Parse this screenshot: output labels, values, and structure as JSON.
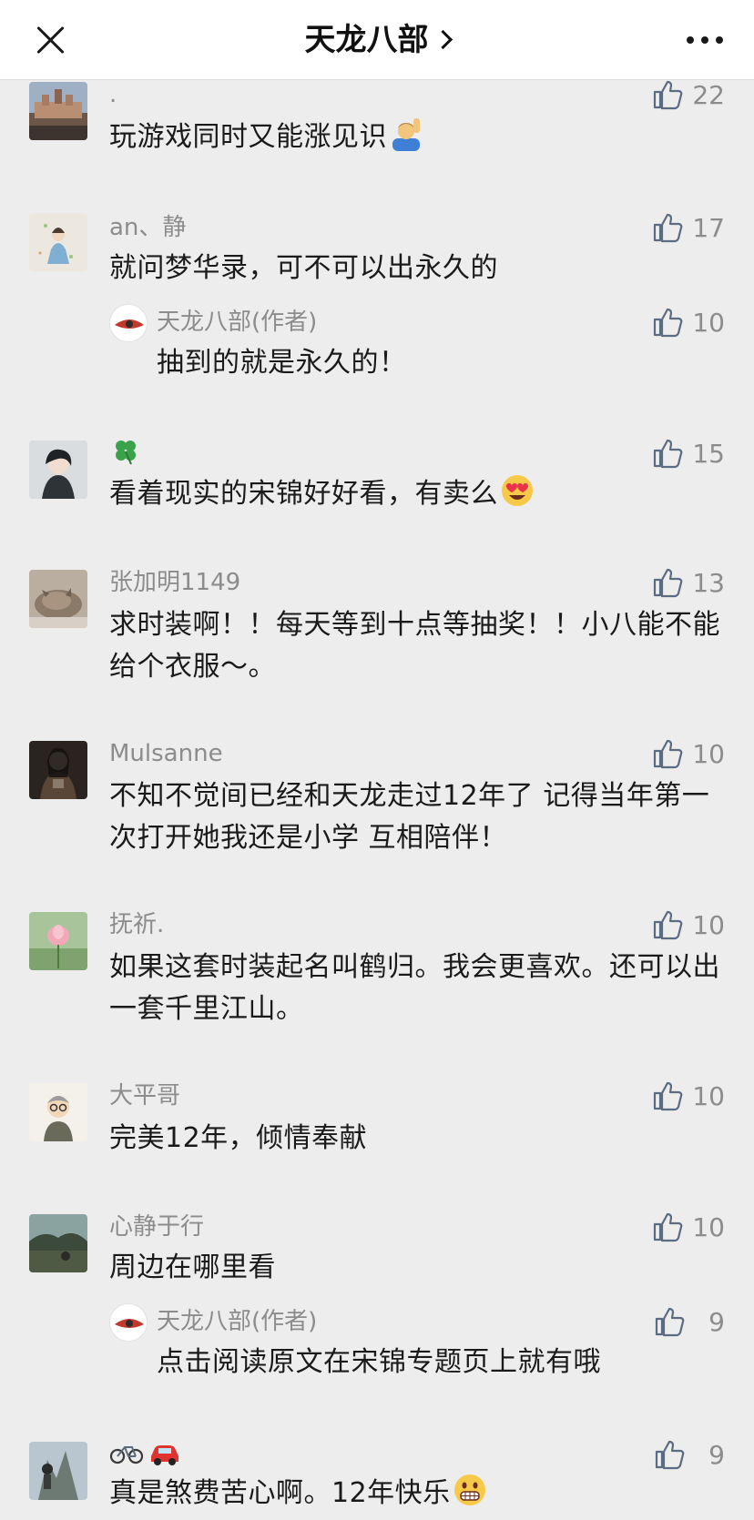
{
  "header": {
    "title": "天龙八部",
    "close_icon": "close-icon",
    "more_icon": "more-dots-icon"
  },
  "colors": {
    "background": "#ededed",
    "header_background": "#ffffff",
    "nickname": "#8c8c8c",
    "text": "#1a1a1a"
  },
  "comments": [
    {
      "nickname": ".",
      "content": "玩游戏同时又能涨见识",
      "emoji": "person-raising-hand-emoji",
      "likes": "22"
    },
    {
      "nickname": "an、静",
      "content": "就问梦华录，可不可以出永久的",
      "likes": "17",
      "reply": {
        "nickname": "天龙八部(作者)",
        "content": "抽到的就是永久的！",
        "likes": "10"
      }
    },
    {
      "nickname": "",
      "nickname_icon": "four-leaf-clover-emoji",
      "content": "看着现实的宋锦好好看，有卖么",
      "emoji": "heart-eyes-emoji",
      "likes": "15"
    },
    {
      "nickname": "张加明1149",
      "content": "求时装啊！！每天等到十点等抽奖！！小八能不能给个衣服～。",
      "likes": "13"
    },
    {
      "nickname": "Mulsanne",
      "content": "不知不觉间已经和天龙走过12年了 记得当年第一次打开她我还是小学 互相陪伴！",
      "likes": "10"
    },
    {
      "nickname": "抚祈.",
      "content": "如果这套时装起名叫鹤归。我会更喜欢。还可以出一套千里江山。",
      "likes": "10"
    },
    {
      "nickname": "大平哥",
      "content": "完美12年，倾情奉献",
      "likes": "10"
    },
    {
      "nickname": "心静于行",
      "content": "周边在哪里看",
      "likes": "10",
      "reply": {
        "nickname": "天龙八部(作者)",
        "content": "点击阅读原文在宋锦专题页上就有哦",
        "likes": "9"
      }
    },
    {
      "nickname": "",
      "nickname_icons": [
        "bicycle-emoji",
        "car-emoji"
      ],
      "content": "真是煞费苦心啊。12年快乐",
      "emoji": "grinning-emoji",
      "likes": "9"
    }
  ]
}
